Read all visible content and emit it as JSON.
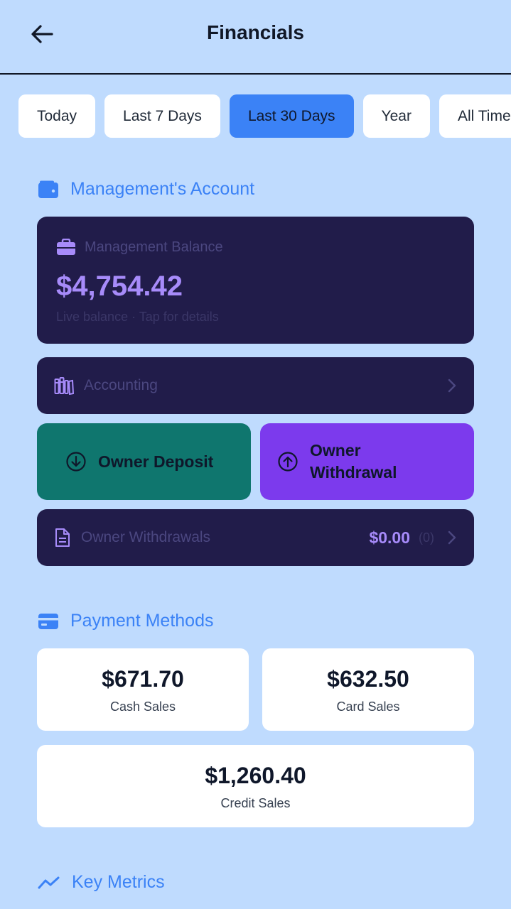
{
  "header": {
    "title": "Financials",
    "back_icon": "arrow-left-icon"
  },
  "tabs": [
    {
      "label": "Today",
      "active": false
    },
    {
      "label": "Last 7 Days",
      "active": false
    },
    {
      "label": "Last 30 Days",
      "active": true
    },
    {
      "label": "Year",
      "active": false
    },
    {
      "label": "All Time",
      "active": false
    }
  ],
  "management": {
    "section_title": "Management's Account",
    "balance_label": "Management Balance",
    "balance": "$4,754.42",
    "balance_sub": "Live balance · Tap for details",
    "accounting_label": "Accounting",
    "deposit_label": "Owner Deposit",
    "withdraw_label": "Owner Withdrawal",
    "withdrawals_label": "Owner Withdrawals",
    "withdrawals_amount": "$0.00",
    "withdrawals_count": "(0)"
  },
  "payment_methods": {
    "section_title": "Payment Methods",
    "cash": {
      "amount": "$671.70",
      "label": "Cash Sales"
    },
    "card": {
      "amount": "$632.50",
      "label": "Card Sales"
    },
    "credit": {
      "amount": "$1,260.40",
      "label": "Credit Sales"
    }
  },
  "key_metrics": {
    "section_title": "Key Metrics"
  },
  "colors": {
    "background": "#bfdbfe",
    "accent": "#3b82f6",
    "dark_card": "#211c4a",
    "deposit": "#0f766e",
    "withdraw": "#7c3aed",
    "balance_text": "#a78bfa"
  }
}
